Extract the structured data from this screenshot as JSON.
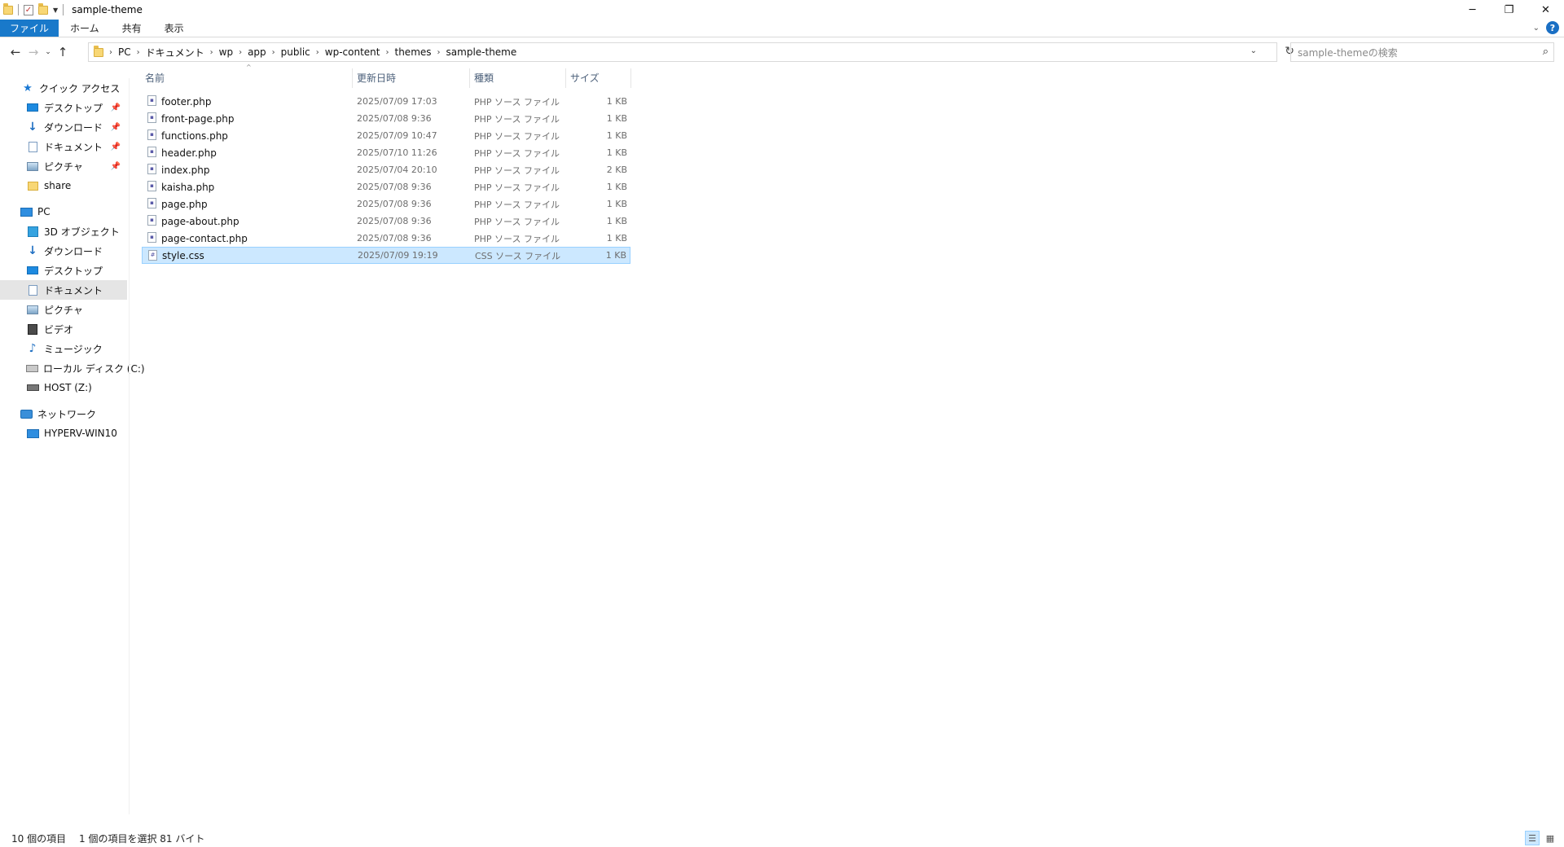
{
  "window": {
    "title": "sample-theme"
  },
  "ribbon": {
    "tabs": [
      "ファイル",
      "ホーム",
      "共有",
      "表示"
    ]
  },
  "address": {
    "path": [
      "PC",
      "ドキュメント",
      "wp",
      "app",
      "public",
      "wp-content",
      "themes",
      "sample-theme"
    ]
  },
  "search": {
    "placeholder": "sample-themeの検索"
  },
  "sidebar": {
    "quick_access": "クイック アクセス",
    "qa_items": [
      "デスクトップ",
      "ダウンロード",
      "ドキュメント",
      "ピクチャ",
      "share"
    ],
    "pc": "PC",
    "pc_items": [
      "3D オブジェクト",
      "ダウンロード",
      "デスクトップ",
      "ドキュメント",
      "ピクチャ",
      "ビデオ",
      "ミュージック",
      "ローカル ディスク (C:)",
      "HOST (Z:)"
    ],
    "network": "ネットワーク",
    "network_items": [
      "HYPERV-WIN10"
    ]
  },
  "columns": {
    "name": "名前",
    "date": "更新日時",
    "type": "種類",
    "size": "サイズ"
  },
  "files": [
    {
      "name": "footer.php",
      "date": "2025/07/09 17:03",
      "type": "PHP ソース ファイル",
      "size": "1 KB"
    },
    {
      "name": "front-page.php",
      "date": "2025/07/08 9:36",
      "type": "PHP ソース ファイル",
      "size": "1 KB"
    },
    {
      "name": "functions.php",
      "date": "2025/07/09 10:47",
      "type": "PHP ソース ファイル",
      "size": "1 KB"
    },
    {
      "name": "header.php",
      "date": "2025/07/10 11:26",
      "type": "PHP ソース ファイル",
      "size": "1 KB"
    },
    {
      "name": "index.php",
      "date": "2025/07/04 20:10",
      "type": "PHP ソース ファイル",
      "size": "2 KB"
    },
    {
      "name": "kaisha.php",
      "date": "2025/07/08 9:36",
      "type": "PHP ソース ファイル",
      "size": "1 KB"
    },
    {
      "name": "page.php",
      "date": "2025/07/08 9:36",
      "type": "PHP ソース ファイル",
      "size": "1 KB"
    },
    {
      "name": "page-about.php",
      "date": "2025/07/08 9:36",
      "type": "PHP ソース ファイル",
      "size": "1 KB"
    },
    {
      "name": "page-contact.php",
      "date": "2025/07/08 9:36",
      "type": "PHP ソース ファイル",
      "size": "1 KB"
    },
    {
      "name": "style.css",
      "date": "2025/07/09 19:19",
      "type": "CSS ソース ファイル",
      "size": "1 KB"
    }
  ],
  "status": {
    "count": "10 個の項目",
    "selection": "1 個の項目を選択  81 バイト"
  }
}
